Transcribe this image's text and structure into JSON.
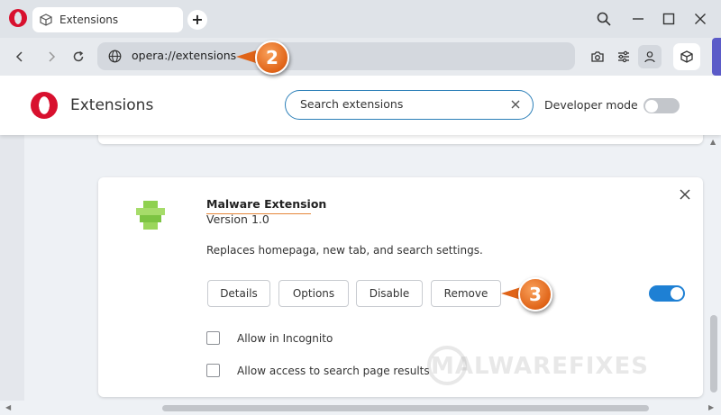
{
  "browser": {
    "tab": {
      "title": "Extensions",
      "icon": "cube-icon"
    },
    "new_tab_label": "+",
    "address": {
      "url": "opera://extensions"
    }
  },
  "page": {
    "title": "Extensions",
    "search": {
      "placeholder": "Search extensions"
    },
    "developer_mode": {
      "label": "Developer mode",
      "enabled": false
    }
  },
  "extension": {
    "name": "Malware Extension",
    "version": "Version 1.0",
    "description": "Replaces homepaga, new tab, and search settings.",
    "buttons": {
      "details": "Details",
      "options": "Options",
      "disable": "Disable",
      "remove": "Remove"
    },
    "enabled": true,
    "options": [
      {
        "label": "Allow in Incognito",
        "checked": false
      },
      {
        "label": "Allow access to search page results",
        "checked": false
      }
    ]
  },
  "callouts": {
    "step2": "2",
    "step3": "3"
  },
  "watermark": "MALWAREFIXES",
  "colors": {
    "opera_red": "#d8102e",
    "accent_blue": "#1e80d4",
    "callout_orange": "#e06418",
    "sidebar_purple": "#5b5bc8"
  }
}
